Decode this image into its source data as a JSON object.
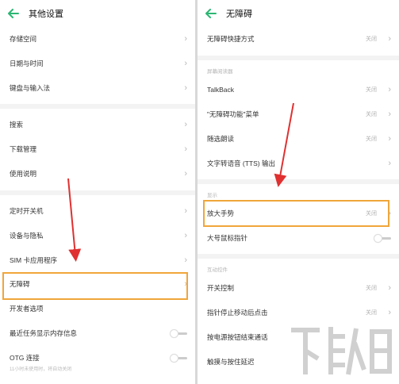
{
  "left": {
    "title": "其他设置",
    "rows": [
      {
        "label": "存储空间",
        "value": ""
      },
      {
        "label": "日期与时间",
        "value": ""
      },
      {
        "label": "键盘与输入法",
        "value": ""
      },
      {
        "label": "搜索",
        "value": ""
      },
      {
        "label": "下载管理",
        "value": ""
      },
      {
        "label": "使用说明",
        "value": ""
      },
      {
        "label": "定时开关机",
        "value": ""
      },
      {
        "label": "设备与隐私",
        "value": ""
      },
      {
        "label": "SIM 卡应用程序",
        "value": ""
      },
      {
        "label": "无障碍",
        "value": ""
      },
      {
        "label": "开发者选项",
        "value": ""
      },
      {
        "label": "最近任务显示内存信息",
        "value": ""
      },
      {
        "label": "OTG 连接",
        "value": ""
      }
    ],
    "otg_sub": "11小时未使用时，将自动关闭"
  },
  "right": {
    "title": "无障碍",
    "rows": [
      {
        "label": "无障碍快捷方式",
        "value": "关闭"
      },
      {
        "label": "TalkBack",
        "value": "关闭"
      },
      {
        "label": "\"无障碍功能\"菜单",
        "value": "关闭"
      },
      {
        "label": "随选朗读",
        "value": "关闭"
      },
      {
        "label": "文字转语音 (TTS) 输出",
        "value": ""
      },
      {
        "label": "放大手势",
        "value": "关闭"
      },
      {
        "label": "大号鼠标指针",
        "value": ""
      },
      {
        "label": "开关控制",
        "value": "关闭"
      },
      {
        "label": "指针停止移动后点击",
        "value": "关闭"
      },
      {
        "label": "按电源按钮结束通话",
        "value": ""
      },
      {
        "label": "触摸与按住延迟",
        "value": ""
      }
    ],
    "sections": {
      "screen_reader": "屏幕阅读器",
      "display": "显示",
      "interaction": "互动控件"
    }
  },
  "watermark": "下载吧",
  "colors": {
    "accent_green": "#2bb673",
    "highlight_orange": "#f0a63a",
    "arrow_red": "#e03030"
  }
}
